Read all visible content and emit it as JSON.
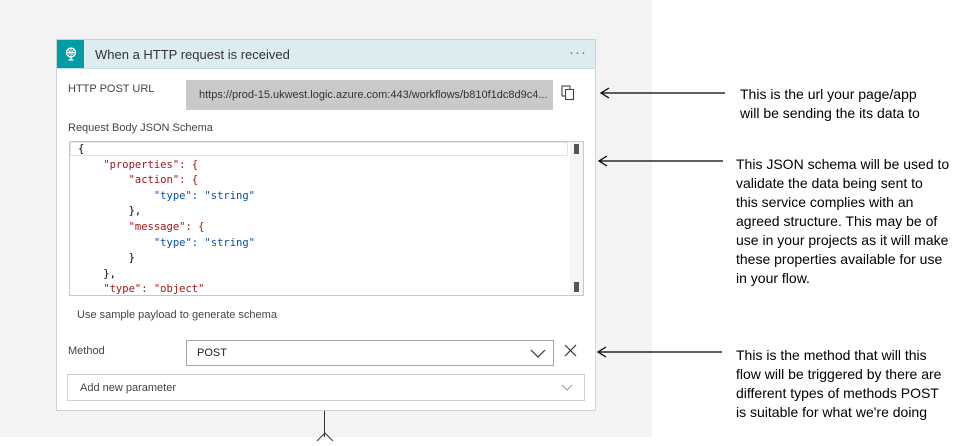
{
  "trigger": {
    "title": "When a HTTP request is received",
    "more": "···",
    "icon": "http-request-icon",
    "accent": "#009ca6"
  },
  "http_post_url": {
    "label": "HTTP POST URL",
    "value": "https://prod-15.ukwest.logic.azure.com:443/workflows/b810f1dc8d9c4...",
    "copy_icon": "copy-icon"
  },
  "schema": {
    "label": "Request Body JSON Schema",
    "lines": [
      "{",
      "    \"properties\": {",
      "        \"action\": {",
      "            \"type\": \"string\"",
      "        },",
      "        \"message\": {",
      "            \"type\": \"string\"",
      "        }",
      "    },",
      "    \"type\": \"object\""
    ]
  },
  "sample_payload_link": "Use sample payload to generate schema",
  "method": {
    "label": "Method",
    "value": "POST"
  },
  "add_parameter": {
    "placeholder": "Add new parameter"
  },
  "annotations": [
    {
      "id": "url",
      "lines": [
        "This is the url your page/app",
        "will be sending the its data to"
      ]
    },
    {
      "id": "schema",
      "lines": [
        "This JSON schema will be used to",
        "validate the data being sent to",
        "this service complies with an",
        "agreed structure. This may be of",
        "use in your projects as it will make",
        "these properties available for use",
        "in your flow."
      ]
    },
    {
      "id": "method",
      "lines": [
        "This is the method that will this",
        "flow will be triggered by there are",
        "different types of methods POST",
        "is suitable for what we're doing"
      ]
    }
  ]
}
